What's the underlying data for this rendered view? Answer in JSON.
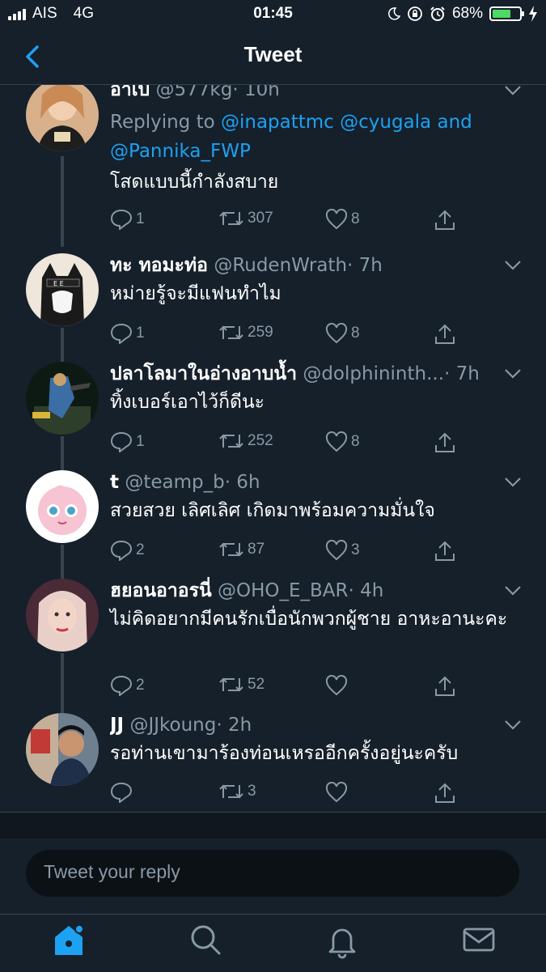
{
  "status_bar": {
    "carrier": "AIS",
    "network": "4G",
    "time": "01:45",
    "battery": "68%",
    "battery_level": 0.68,
    "icons": [
      "signal-bars-icon",
      "moon-icon",
      "rotation-lock-icon",
      "alarm-icon",
      "battery-icon",
      "charging-bolt-icon"
    ]
  },
  "nav": {
    "title": "Tweet",
    "back_icon": "chevron-left-icon"
  },
  "colors": {
    "background": "#15202b",
    "accent": "#1da1f2",
    "muted": "#8899a6",
    "like": "#e0245e"
  },
  "tweets": [
    {
      "name": "อาเบ",
      "handle": "@577kg",
      "time": "· 10h",
      "replying_label": "Replying to",
      "reply_to": [
        "@inapattmc",
        "@cyugala",
        "@Pannika_FWP"
      ],
      "reply_and": "and",
      "text": "โสดแบบนี้กำลังสบาย",
      "replies": "1",
      "retweets": "307",
      "likes": "8"
    },
    {
      "name": "ทะ ทอมะท่อ",
      "handle": "@RudenWrath",
      "time": "· 7h",
      "text": "หม่ายรู้จะมีแฟนทำไม",
      "replies": "1",
      "retweets": "259",
      "likes": "8"
    },
    {
      "name": "ปลาโลมาในอ่างอาบน้ำ",
      "handle": "@dolphininth...",
      "time": "· 7h",
      "text": "ทิ้งเบอร์เอาไว้ก็ดีนะ",
      "replies": "1",
      "retweets": "252",
      "likes": "8"
    },
    {
      "name": "t",
      "handle": "@teamp_b",
      "time": "· 6h",
      "text": "สวยสวย เลิศเลิศ เกิดมาพร้อมความมั่นใจ",
      "replies": "2",
      "retweets": "87",
      "likes": "3"
    },
    {
      "name": "ฮยอนอาอรนี่",
      "handle": "@OHO_E_BAR",
      "time": "· 4h",
      "text": "ไม่คิดอยากมีคนรักเบื่อนักพวกผู้ชาย อาหะอานะคะ",
      "replies": "2",
      "retweets": "52",
      "likes": ""
    },
    {
      "name": "JJ",
      "handle": "@JJkoung",
      "time": "· 2h",
      "text": "รอท่านเขามาร้องท่อนเหรออีกครั้งอยู่นะครับ",
      "replies": "",
      "retweets": "3",
      "likes": ""
    }
  ],
  "reply_box": {
    "placeholder": "Tweet your reply"
  },
  "tab_bar": {
    "tabs": [
      "home-icon",
      "search-icon",
      "notifications-icon",
      "messages-icon"
    ],
    "active": "home-icon"
  }
}
